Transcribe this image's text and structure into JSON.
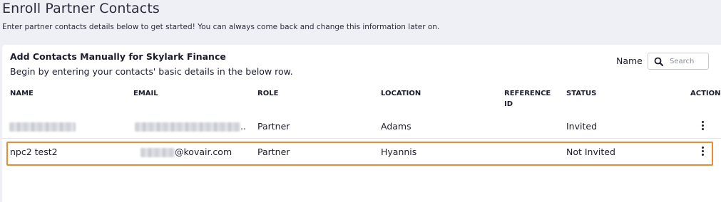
{
  "header": {
    "title": "Enroll Partner Contacts",
    "subtitle": "Enter partner contacts details below to get started! You can always come back and change this information later on."
  },
  "card": {
    "title": "Add Contacts Manually for Skylark Finance",
    "description": "Begin by entering your contacts' basic details in the below row."
  },
  "search": {
    "label": "Name",
    "placeholder": "Search",
    "icon": "search-icon"
  },
  "table": {
    "columns": [
      "NAME",
      "EMAIL",
      "ROLE",
      "LOCATION",
      "REFERENCE ID",
      "STATUS",
      "ACTION"
    ],
    "rows": [
      {
        "name": "",
        "email": "..",
        "role": "Partner",
        "location": "Adams",
        "reference_id": "",
        "status": "Invited",
        "action_icon": "more-vertical-icon"
      },
      {
        "name": "npc2 test2",
        "email": "@kovair.com",
        "role": "Partner",
        "location": "Hyannis",
        "reference_id": "",
        "status": "Not Invited",
        "action_icon": "more-vertical-icon"
      }
    ]
  },
  "colors": {
    "page_bg": "#eef0f5",
    "card_bg": "#ffffff",
    "highlight": "#ee8a2f",
    "text": "#1b1d2e"
  }
}
